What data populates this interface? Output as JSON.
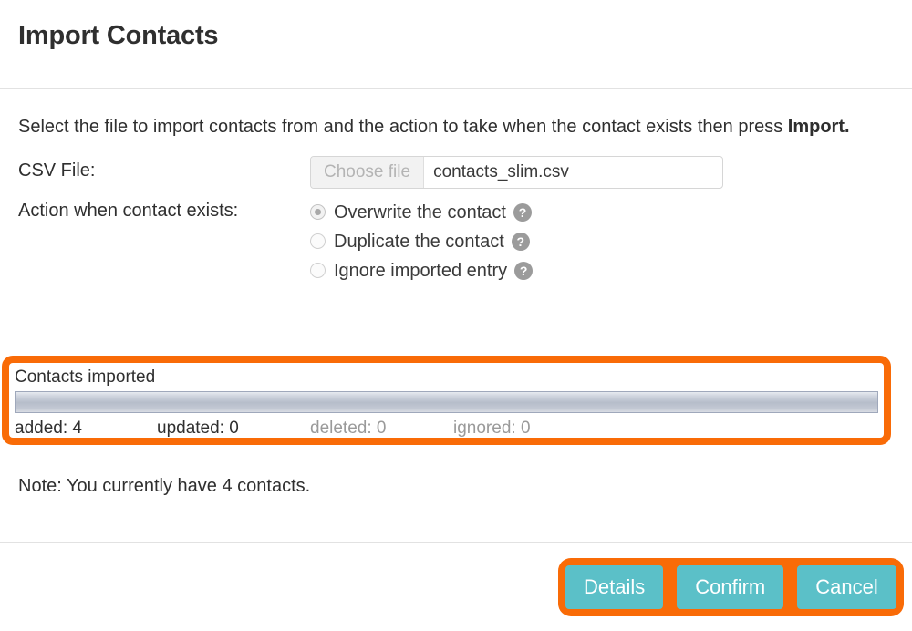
{
  "dialog": {
    "title": "Import Contacts",
    "intro_prefix": "Select the file to import contacts from and the action to take when the contact exists then press ",
    "intro_bold": "Import.",
    "note": "Note: You currently have 4 contacts."
  },
  "form": {
    "csv_label": "CSV File:",
    "file_input": {
      "button_label": "Choose file",
      "file_name": "contacts_slim.csv"
    },
    "action_label": "Action when contact exists:",
    "radio_options": [
      {
        "label": "Overwrite the contact",
        "checked": true,
        "help": "?"
      },
      {
        "label": "Duplicate the contact",
        "checked": false,
        "help": "?"
      },
      {
        "label": "Ignore imported entry",
        "checked": false,
        "help": "?"
      }
    ]
  },
  "progress": {
    "caption": "Contacts imported",
    "percent": 100,
    "stats": [
      {
        "label": "added: 4",
        "muted": false
      },
      {
        "label": "updated: 0",
        "muted": false
      },
      {
        "label": "deleted: 0",
        "muted": true
      },
      {
        "label": "ignored: 0",
        "muted": true
      }
    ]
  },
  "footer": {
    "buttons": [
      {
        "label": "Details"
      },
      {
        "label": "Confirm"
      },
      {
        "label": "Cancel"
      }
    ]
  },
  "colors": {
    "highlight": "#f96b07",
    "button": "#5bc0c8",
    "help_icon": "#9b9b9b",
    "text": "#2f2f2f",
    "muted_text": "#9a9a9a"
  }
}
